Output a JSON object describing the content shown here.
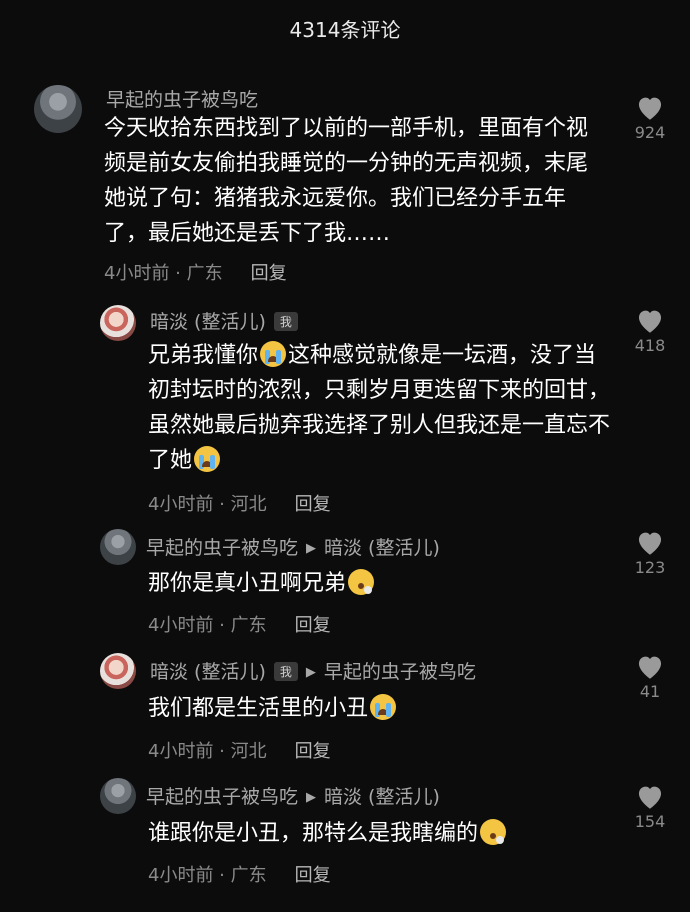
{
  "header": {
    "title": "4314条评论"
  },
  "reply_label": "回复",
  "comments": [
    {
      "user": "早起的虫子被鸟吃",
      "text": "今天收拾东西找到了以前的一部手机，里面有个视频是前女友偷拍我睡觉的一分钟的无声视频，末尾她说了句：猪猪我永远爱你。我们已经分手五年了，最后她还是丢下了我……",
      "time": "4小时前 · 广东",
      "likes": "924"
    },
    {
      "user": "暗淡 (整活儿)",
      "badge": "我",
      "text_parts": [
        "兄弟我懂你",
        "这种感觉就像是一坛酒，没了当初封坛时的浓烈，只剩岁月更迭留下来的回甘，虽然她最后抛弃我选择了别人但我还是一直忘不了她"
      ],
      "time": "4小时前 · 河北",
      "likes": "418"
    },
    {
      "user": "早起的虫子被鸟吃",
      "reply_to": "暗淡 (整活儿)",
      "text": "那你是真小丑啊兄弟",
      "time": "4小时前 · 广东",
      "likes": "123"
    },
    {
      "user": "暗淡 (整活儿)",
      "badge": "我",
      "reply_to": "早起的虫子被鸟吃",
      "text": "我们都是生活里的小丑",
      "time": "4小时前 · 河北",
      "likes": "41"
    },
    {
      "user": "早起的虫子被鸟吃",
      "reply_to": "暗淡 (整活儿)",
      "text": "谁跟你是小丑，那特么是我瞎编的",
      "time": "4小时前 · 广东",
      "likes": "154"
    }
  ]
}
